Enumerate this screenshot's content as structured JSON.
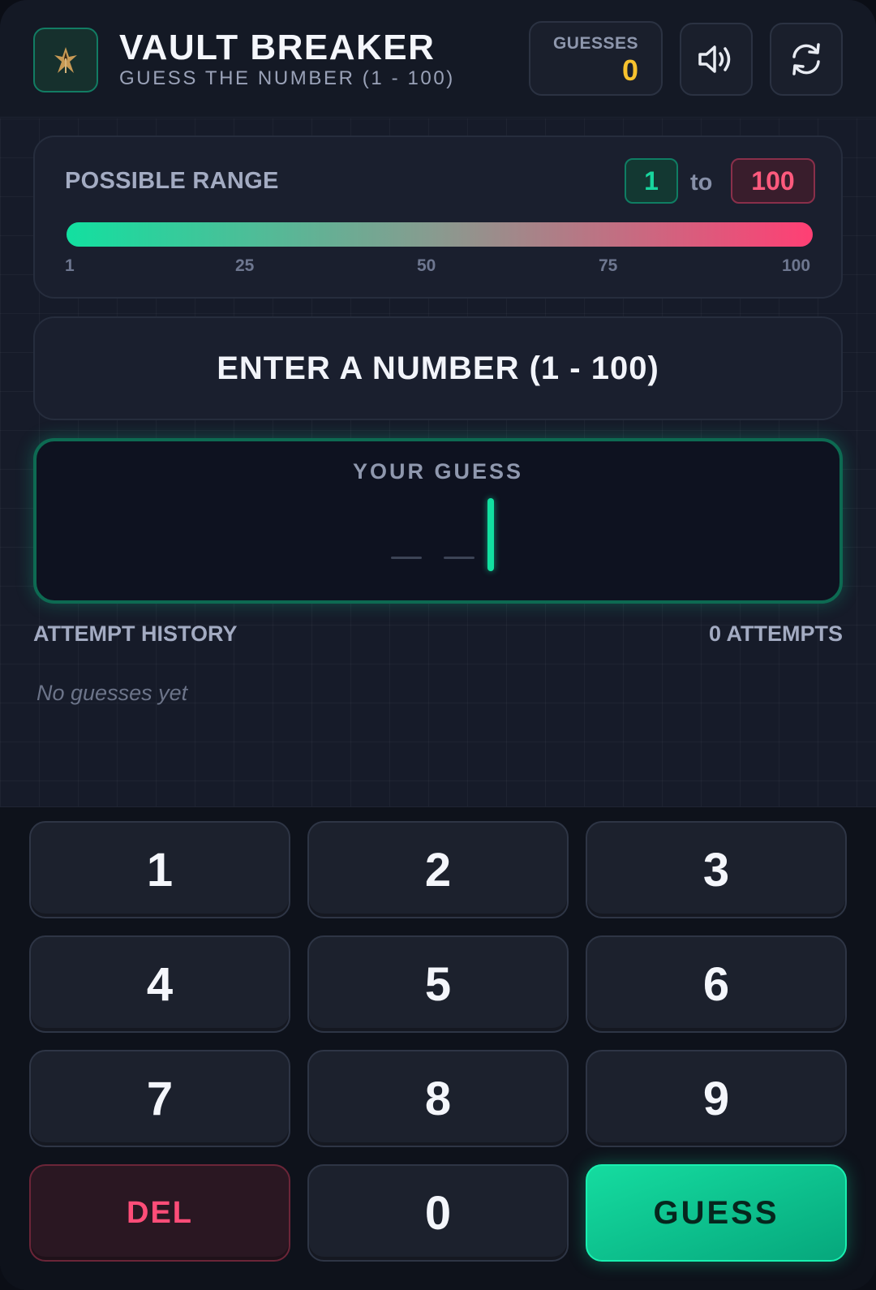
{
  "header": {
    "title": "VAULT BREAKER",
    "subtitle": "GUESS THE NUMBER (1 - 100)",
    "guesses_label": "GUESSES",
    "guesses_value": "0",
    "logo_icon": "vault-emblem-icon",
    "sound_icon": "speaker-volume-icon",
    "reset_icon": "refresh-icon"
  },
  "range": {
    "label": "POSSIBLE RANGE",
    "low": "1",
    "to": "to",
    "high": "100",
    "fill_fraction": 1.0,
    "ticks": [
      "1",
      "25",
      "50",
      "75",
      "100"
    ]
  },
  "message": "ENTER A NUMBER (1 - 100)",
  "guess": {
    "label": "YOUR GUESS",
    "value": ""
  },
  "history": {
    "title": "ATTEMPT HISTORY",
    "count": "0 ATTEMPTS",
    "empty": "No guesses yet"
  },
  "keypad": {
    "keys": [
      "1",
      "2",
      "3",
      "4",
      "5",
      "6",
      "7",
      "8",
      "9"
    ],
    "delete": "DEL",
    "zero": "0",
    "submit": "GUESS"
  },
  "colors": {
    "accent": "#12e0a0",
    "danger": "#ff4d78",
    "counter": "#f7c22e",
    "background": "#121623"
  }
}
